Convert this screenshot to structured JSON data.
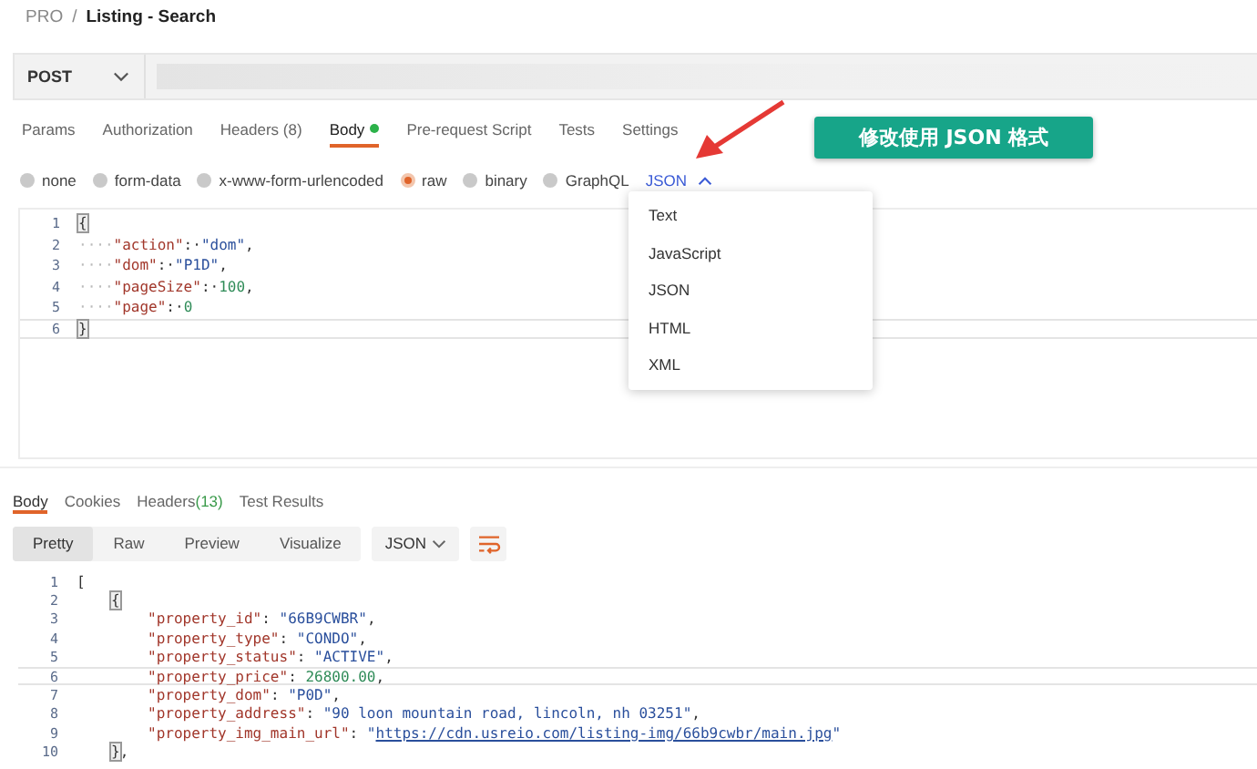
{
  "breadcrumb": {
    "workspace": "PRO",
    "separator": "/",
    "title": "Listing - Search"
  },
  "request": {
    "method": "POST"
  },
  "request_tabs": [
    {
      "label": "Params",
      "selected": false
    },
    {
      "label": "Authorization",
      "selected": false
    },
    {
      "label": "Headers (8)",
      "selected": false
    },
    {
      "label": "Body",
      "selected": true,
      "dot": true
    },
    {
      "label": "Pre-request Script",
      "selected": false
    },
    {
      "label": "Tests",
      "selected": false
    },
    {
      "label": "Settings",
      "selected": false
    }
  ],
  "body_types": [
    {
      "label": "none",
      "selected": false
    },
    {
      "label": "form-data",
      "selected": false
    },
    {
      "label": "x-www-form-urlencoded",
      "selected": false
    },
    {
      "label": "raw",
      "selected": true
    },
    {
      "label": "binary",
      "selected": false
    },
    {
      "label": "GraphQL",
      "selected": false
    }
  ],
  "format_picker": {
    "label": "JSON",
    "expanded": true
  },
  "callout": {
    "text": "修改使用 JSON 格式"
  },
  "format_menu": [
    {
      "label": "Text"
    },
    {
      "label": "JavaScript"
    },
    {
      "label": "JSON"
    },
    {
      "label": "HTML"
    },
    {
      "label": "XML"
    }
  ],
  "request_body": [
    {
      "number": "1",
      "current": false,
      "tokens": [
        {
          "kind": "brace",
          "text": "{"
        }
      ]
    },
    {
      "number": "2",
      "current": false,
      "tokens": [
        {
          "kind": "ws",
          "text": "····"
        },
        {
          "kind": "key",
          "text": "\"action\""
        },
        {
          "kind": "punct",
          "text": ":·"
        },
        {
          "kind": "str",
          "text": "\"dom\""
        },
        {
          "kind": "punct",
          "text": ","
        }
      ]
    },
    {
      "number": "3",
      "current": false,
      "tokens": [
        {
          "kind": "ws",
          "text": "····"
        },
        {
          "kind": "key",
          "text": "\"dom\""
        },
        {
          "kind": "punct",
          "text": ":·"
        },
        {
          "kind": "str",
          "text": "\"P1D\""
        },
        {
          "kind": "punct",
          "text": ","
        }
      ]
    },
    {
      "number": "4",
      "current": false,
      "tokens": [
        {
          "kind": "ws",
          "text": "····"
        },
        {
          "kind": "key",
          "text": "\"pageSize\""
        },
        {
          "kind": "punct",
          "text": ":·"
        },
        {
          "kind": "num",
          "text": "100"
        },
        {
          "kind": "punct",
          "text": ","
        }
      ]
    },
    {
      "number": "5",
      "current": false,
      "tokens": [
        {
          "kind": "ws",
          "text": "····"
        },
        {
          "kind": "key",
          "text": "\"page\""
        },
        {
          "kind": "punct",
          "text": ":·"
        },
        {
          "kind": "num",
          "text": "0"
        }
      ]
    },
    {
      "number": "6",
      "current": true,
      "tokens": [
        {
          "kind": "brace",
          "text": "}"
        }
      ]
    }
  ],
  "response_tabs": [
    {
      "label": "Body",
      "selected": true
    },
    {
      "label": "Cookies",
      "selected": false
    },
    {
      "label": "Headers",
      "count": "(13)",
      "selected": false
    },
    {
      "label": "Test Results",
      "selected": false
    }
  ],
  "view_modes": [
    {
      "label": "Pretty",
      "selected": true
    },
    {
      "label": "Raw",
      "selected": false
    },
    {
      "label": "Preview",
      "selected": false
    },
    {
      "label": "Visualize",
      "selected": false
    }
  ],
  "response_format": {
    "label": "JSON"
  },
  "response_body": [
    {
      "number": "1",
      "current": false,
      "kind": "top",
      "tokens": [
        {
          "kind": "punct",
          "text": "["
        }
      ]
    },
    {
      "number": "2",
      "current": false,
      "kind": "inner",
      "tokens": [
        {
          "kind": "brace",
          "text": "{"
        }
      ]
    },
    {
      "number": "3",
      "current": false,
      "kind": "member",
      "tokens": [
        {
          "kind": "key",
          "text": "\"property_id\""
        },
        {
          "kind": "punct",
          "text": ": "
        },
        {
          "kind": "str",
          "text": "\"66B9CWBR\""
        },
        {
          "kind": "punct",
          "text": ","
        }
      ]
    },
    {
      "number": "4",
      "current": false,
      "kind": "member",
      "tokens": [
        {
          "kind": "key",
          "text": "\"property_type\""
        },
        {
          "kind": "punct",
          "text": ": "
        },
        {
          "kind": "str",
          "text": "\"CONDO\""
        },
        {
          "kind": "punct",
          "text": ","
        }
      ]
    },
    {
      "number": "5",
      "current": false,
      "kind": "member",
      "tokens": [
        {
          "kind": "key",
          "text": "\"property_status\""
        },
        {
          "kind": "punct",
          "text": ": "
        },
        {
          "kind": "str",
          "text": "\"ACTIVE\""
        },
        {
          "kind": "punct",
          "text": ","
        }
      ]
    },
    {
      "number": "6",
      "current": true,
      "kind": "member",
      "tokens": [
        {
          "kind": "key",
          "text": "\"property_price\""
        },
        {
          "kind": "punct",
          "text": ": "
        },
        {
          "kind": "num",
          "text": "26800.00"
        },
        {
          "kind": "punct",
          "text": ","
        }
      ]
    },
    {
      "number": "7",
      "current": false,
      "kind": "member",
      "tokens": [
        {
          "kind": "key",
          "text": "\"property_dom\""
        },
        {
          "kind": "punct",
          "text": ": "
        },
        {
          "kind": "str",
          "text": "\"P0D\""
        },
        {
          "kind": "punct",
          "text": ","
        }
      ]
    },
    {
      "number": "8",
      "current": false,
      "kind": "member",
      "tokens": [
        {
          "kind": "key",
          "text": "\"property_address\""
        },
        {
          "kind": "punct",
          "text": ": "
        },
        {
          "kind": "str",
          "text": "\"90 loon mountain road, lincoln, nh 03251\""
        },
        {
          "kind": "punct",
          "text": ","
        }
      ]
    },
    {
      "number": "9",
      "current": false,
      "kind": "member",
      "tokens": [
        {
          "kind": "key",
          "text": "\"property_img_main_url\""
        },
        {
          "kind": "punct",
          "text": ": "
        },
        {
          "kind": "str",
          "text": "\""
        },
        {
          "kind": "link",
          "text": "https://cdn.usreio.com/listing-img/66b9cwbr/main.jpg"
        },
        {
          "kind": "str",
          "text": "\""
        }
      ]
    },
    {
      "number": "10",
      "current": false,
      "kind": "inner",
      "tokens": [
        {
          "kind": "brace",
          "text": "}"
        },
        {
          "kind": "punct",
          "text": ","
        }
      ]
    }
  ]
}
